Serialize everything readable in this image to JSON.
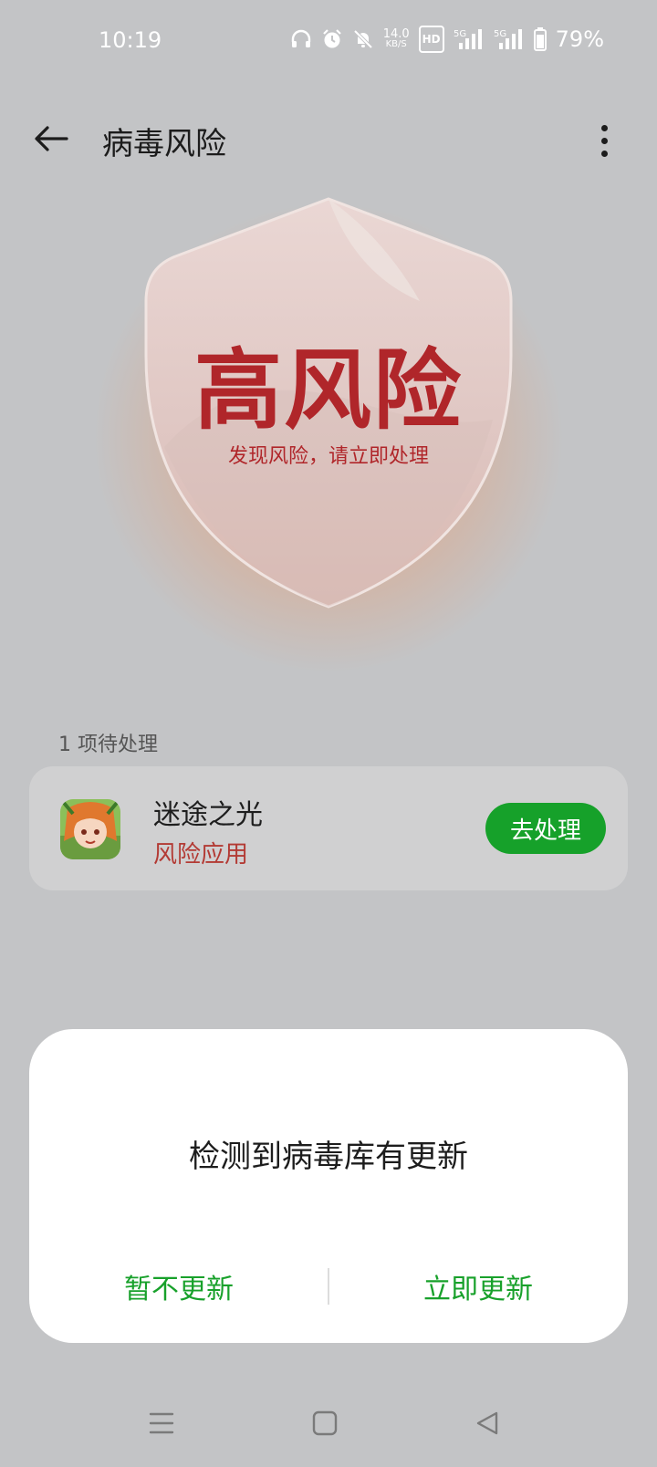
{
  "status_bar": {
    "time": "10:19",
    "net_speed_value": "14.0",
    "net_speed_unit": "KB/S",
    "hd_label": "HD",
    "signal1_label": "5G",
    "signal2_label": "5G",
    "battery": "79%"
  },
  "header": {
    "title": "病毒风险",
    "back_icon": "arrow-left-icon",
    "more_icon": "more-vertical-icon"
  },
  "hero": {
    "level": "高风险",
    "subtitle": "发现风险，请立即处理",
    "accent_color": "#b0262a"
  },
  "pending": {
    "count_label": "1 项待处理",
    "items": [
      {
        "name": "迷途之光",
        "status": "风险应用",
        "action": "去处理"
      }
    ]
  },
  "dialog": {
    "message": "检测到病毒库有更新",
    "cancel_label": "暂不更新",
    "confirm_label": "立即更新",
    "button_color": "#18a12b"
  },
  "nav_bar": {
    "menu_icon": "menu-icon",
    "home_icon": "home-square-icon",
    "back_icon": "back-triangle-icon"
  }
}
